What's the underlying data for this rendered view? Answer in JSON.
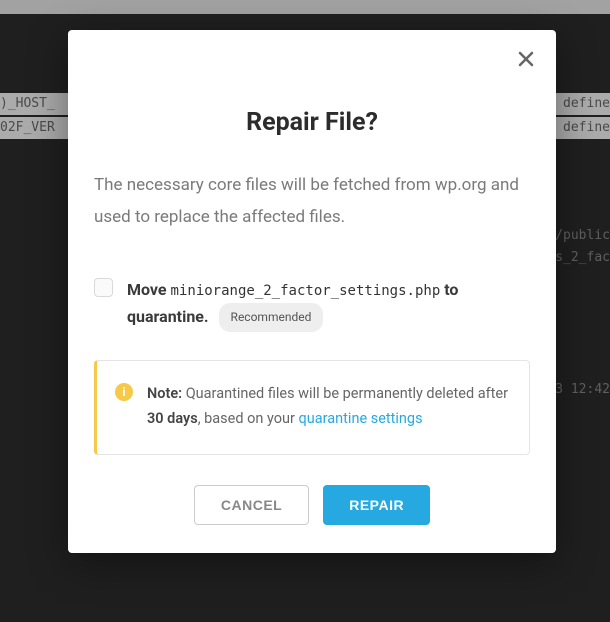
{
  "background": {
    "line1_left": ")_HOST_",
    "line1_right": "define",
    "line2_left": "02F_VER",
    "line2_right": "define",
    "line3_right": "/public",
    "line4_right": "s_2_fac",
    "line5_right": "3 12:42"
  },
  "modal": {
    "title": "Repair File?",
    "description": "The necessary core files will be fetched from wp.org and used to replace the affected files.",
    "checkbox": {
      "prefix": "Move",
      "filename": "miniorange_2_factor_settings.php",
      "suffix": "to quarantine.",
      "badge": "Recommended"
    },
    "note": {
      "label": "Note:",
      "text_before": "Quarantined files will be permanently deleted after",
      "days": "30 days",
      "text_after": ", based on your",
      "link": "quarantine settings"
    },
    "actions": {
      "cancel": "CANCEL",
      "repair": "REPAIR"
    }
  }
}
